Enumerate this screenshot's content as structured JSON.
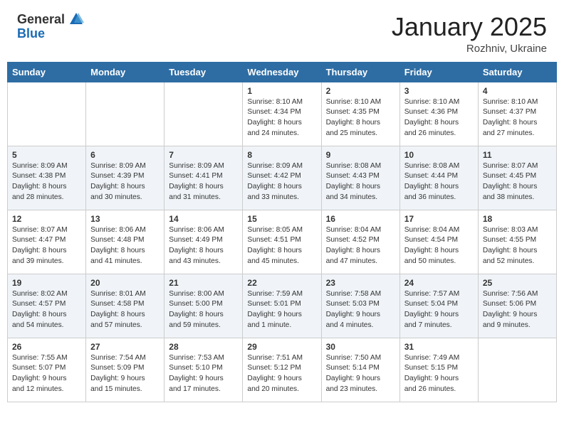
{
  "header": {
    "logo_general": "General",
    "logo_blue": "Blue",
    "month": "January 2025",
    "location": "Rozhniv, Ukraine"
  },
  "weekdays": [
    "Sunday",
    "Monday",
    "Tuesday",
    "Wednesday",
    "Thursday",
    "Friday",
    "Saturday"
  ],
  "weeks": [
    [
      {
        "day": "",
        "text": ""
      },
      {
        "day": "",
        "text": ""
      },
      {
        "day": "",
        "text": ""
      },
      {
        "day": "1",
        "text": "Sunrise: 8:10 AM\nSunset: 4:34 PM\nDaylight: 8 hours\nand 24 minutes."
      },
      {
        "day": "2",
        "text": "Sunrise: 8:10 AM\nSunset: 4:35 PM\nDaylight: 8 hours\nand 25 minutes."
      },
      {
        "day": "3",
        "text": "Sunrise: 8:10 AM\nSunset: 4:36 PM\nDaylight: 8 hours\nand 26 minutes."
      },
      {
        "day": "4",
        "text": "Sunrise: 8:10 AM\nSunset: 4:37 PM\nDaylight: 8 hours\nand 27 minutes."
      }
    ],
    [
      {
        "day": "5",
        "text": "Sunrise: 8:09 AM\nSunset: 4:38 PM\nDaylight: 8 hours\nand 28 minutes."
      },
      {
        "day": "6",
        "text": "Sunrise: 8:09 AM\nSunset: 4:39 PM\nDaylight: 8 hours\nand 30 minutes."
      },
      {
        "day": "7",
        "text": "Sunrise: 8:09 AM\nSunset: 4:41 PM\nDaylight: 8 hours\nand 31 minutes."
      },
      {
        "day": "8",
        "text": "Sunrise: 8:09 AM\nSunset: 4:42 PM\nDaylight: 8 hours\nand 33 minutes."
      },
      {
        "day": "9",
        "text": "Sunrise: 8:08 AM\nSunset: 4:43 PM\nDaylight: 8 hours\nand 34 minutes."
      },
      {
        "day": "10",
        "text": "Sunrise: 8:08 AM\nSunset: 4:44 PM\nDaylight: 8 hours\nand 36 minutes."
      },
      {
        "day": "11",
        "text": "Sunrise: 8:07 AM\nSunset: 4:45 PM\nDaylight: 8 hours\nand 38 minutes."
      }
    ],
    [
      {
        "day": "12",
        "text": "Sunrise: 8:07 AM\nSunset: 4:47 PM\nDaylight: 8 hours\nand 39 minutes."
      },
      {
        "day": "13",
        "text": "Sunrise: 8:06 AM\nSunset: 4:48 PM\nDaylight: 8 hours\nand 41 minutes."
      },
      {
        "day": "14",
        "text": "Sunrise: 8:06 AM\nSunset: 4:49 PM\nDaylight: 8 hours\nand 43 minutes."
      },
      {
        "day": "15",
        "text": "Sunrise: 8:05 AM\nSunset: 4:51 PM\nDaylight: 8 hours\nand 45 minutes."
      },
      {
        "day": "16",
        "text": "Sunrise: 8:04 AM\nSunset: 4:52 PM\nDaylight: 8 hours\nand 47 minutes."
      },
      {
        "day": "17",
        "text": "Sunrise: 8:04 AM\nSunset: 4:54 PM\nDaylight: 8 hours\nand 50 minutes."
      },
      {
        "day": "18",
        "text": "Sunrise: 8:03 AM\nSunset: 4:55 PM\nDaylight: 8 hours\nand 52 minutes."
      }
    ],
    [
      {
        "day": "19",
        "text": "Sunrise: 8:02 AM\nSunset: 4:57 PM\nDaylight: 8 hours\nand 54 minutes."
      },
      {
        "day": "20",
        "text": "Sunrise: 8:01 AM\nSunset: 4:58 PM\nDaylight: 8 hours\nand 57 minutes."
      },
      {
        "day": "21",
        "text": "Sunrise: 8:00 AM\nSunset: 5:00 PM\nDaylight: 8 hours\nand 59 minutes."
      },
      {
        "day": "22",
        "text": "Sunrise: 7:59 AM\nSunset: 5:01 PM\nDaylight: 9 hours\nand 1 minute."
      },
      {
        "day": "23",
        "text": "Sunrise: 7:58 AM\nSunset: 5:03 PM\nDaylight: 9 hours\nand 4 minutes."
      },
      {
        "day": "24",
        "text": "Sunrise: 7:57 AM\nSunset: 5:04 PM\nDaylight: 9 hours\nand 7 minutes."
      },
      {
        "day": "25",
        "text": "Sunrise: 7:56 AM\nSunset: 5:06 PM\nDaylight: 9 hours\nand 9 minutes."
      }
    ],
    [
      {
        "day": "26",
        "text": "Sunrise: 7:55 AM\nSunset: 5:07 PM\nDaylight: 9 hours\nand 12 minutes."
      },
      {
        "day": "27",
        "text": "Sunrise: 7:54 AM\nSunset: 5:09 PM\nDaylight: 9 hours\nand 15 minutes."
      },
      {
        "day": "28",
        "text": "Sunrise: 7:53 AM\nSunset: 5:10 PM\nDaylight: 9 hours\nand 17 minutes."
      },
      {
        "day": "29",
        "text": "Sunrise: 7:51 AM\nSunset: 5:12 PM\nDaylight: 9 hours\nand 20 minutes."
      },
      {
        "day": "30",
        "text": "Sunrise: 7:50 AM\nSunset: 5:14 PM\nDaylight: 9 hours\nand 23 minutes."
      },
      {
        "day": "31",
        "text": "Sunrise: 7:49 AM\nSunset: 5:15 PM\nDaylight: 9 hours\nand 26 minutes."
      },
      {
        "day": "",
        "text": ""
      }
    ]
  ]
}
